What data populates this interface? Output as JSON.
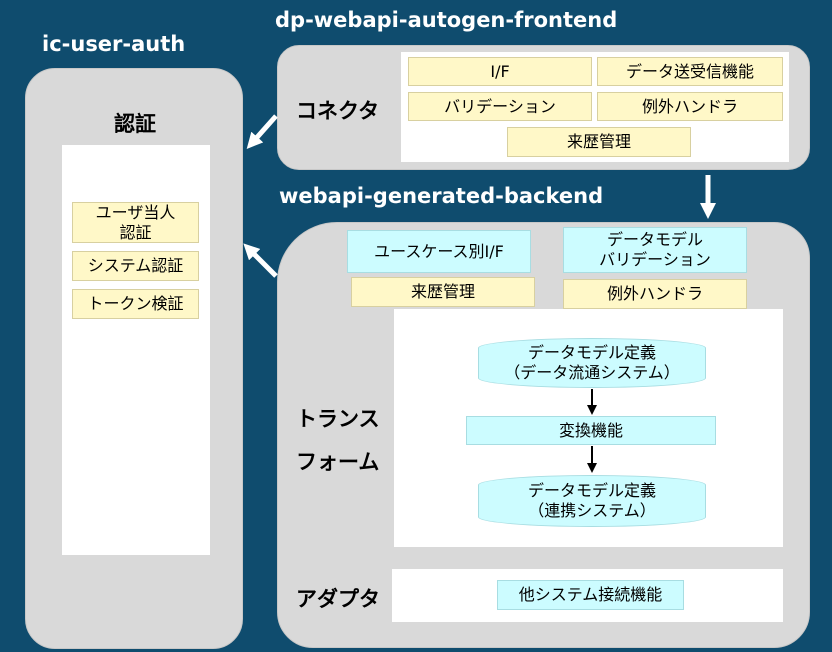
{
  "titles": {
    "auth": "ic-user-auth",
    "frontend": "dp-webapi-autogen-frontend",
    "backend": "webapi-generated-backend"
  },
  "auth": {
    "label": "認証",
    "items": [
      "ユーザ当人\n認証",
      "システム認証",
      "トークン検証"
    ]
  },
  "frontend": {
    "label": "コネクタ",
    "items": [
      "I/F",
      "データ送受信機能",
      "バリデーション",
      "例外ハンドラ",
      "来歴管理"
    ]
  },
  "backend": {
    "top_items": [
      "ユースケース別I/F",
      "データモデル\nバリデーション",
      "来歴管理",
      "例外ハンドラ"
    ],
    "transform": {
      "label": "トランス\nフォーム",
      "source_db": "データモデル定義\n（データ流通システム）",
      "converter": "変換機能",
      "target_db": "データモデル定義\n（連携システム）"
    },
    "adapter": {
      "label": "アダプタ",
      "item": "他システム接続機能"
    }
  },
  "colors": {
    "background": "#0f4c6e",
    "panel": "#d9d9d9",
    "yellow_box": "#fff8c8",
    "cyan_box": "#ccfcff"
  }
}
